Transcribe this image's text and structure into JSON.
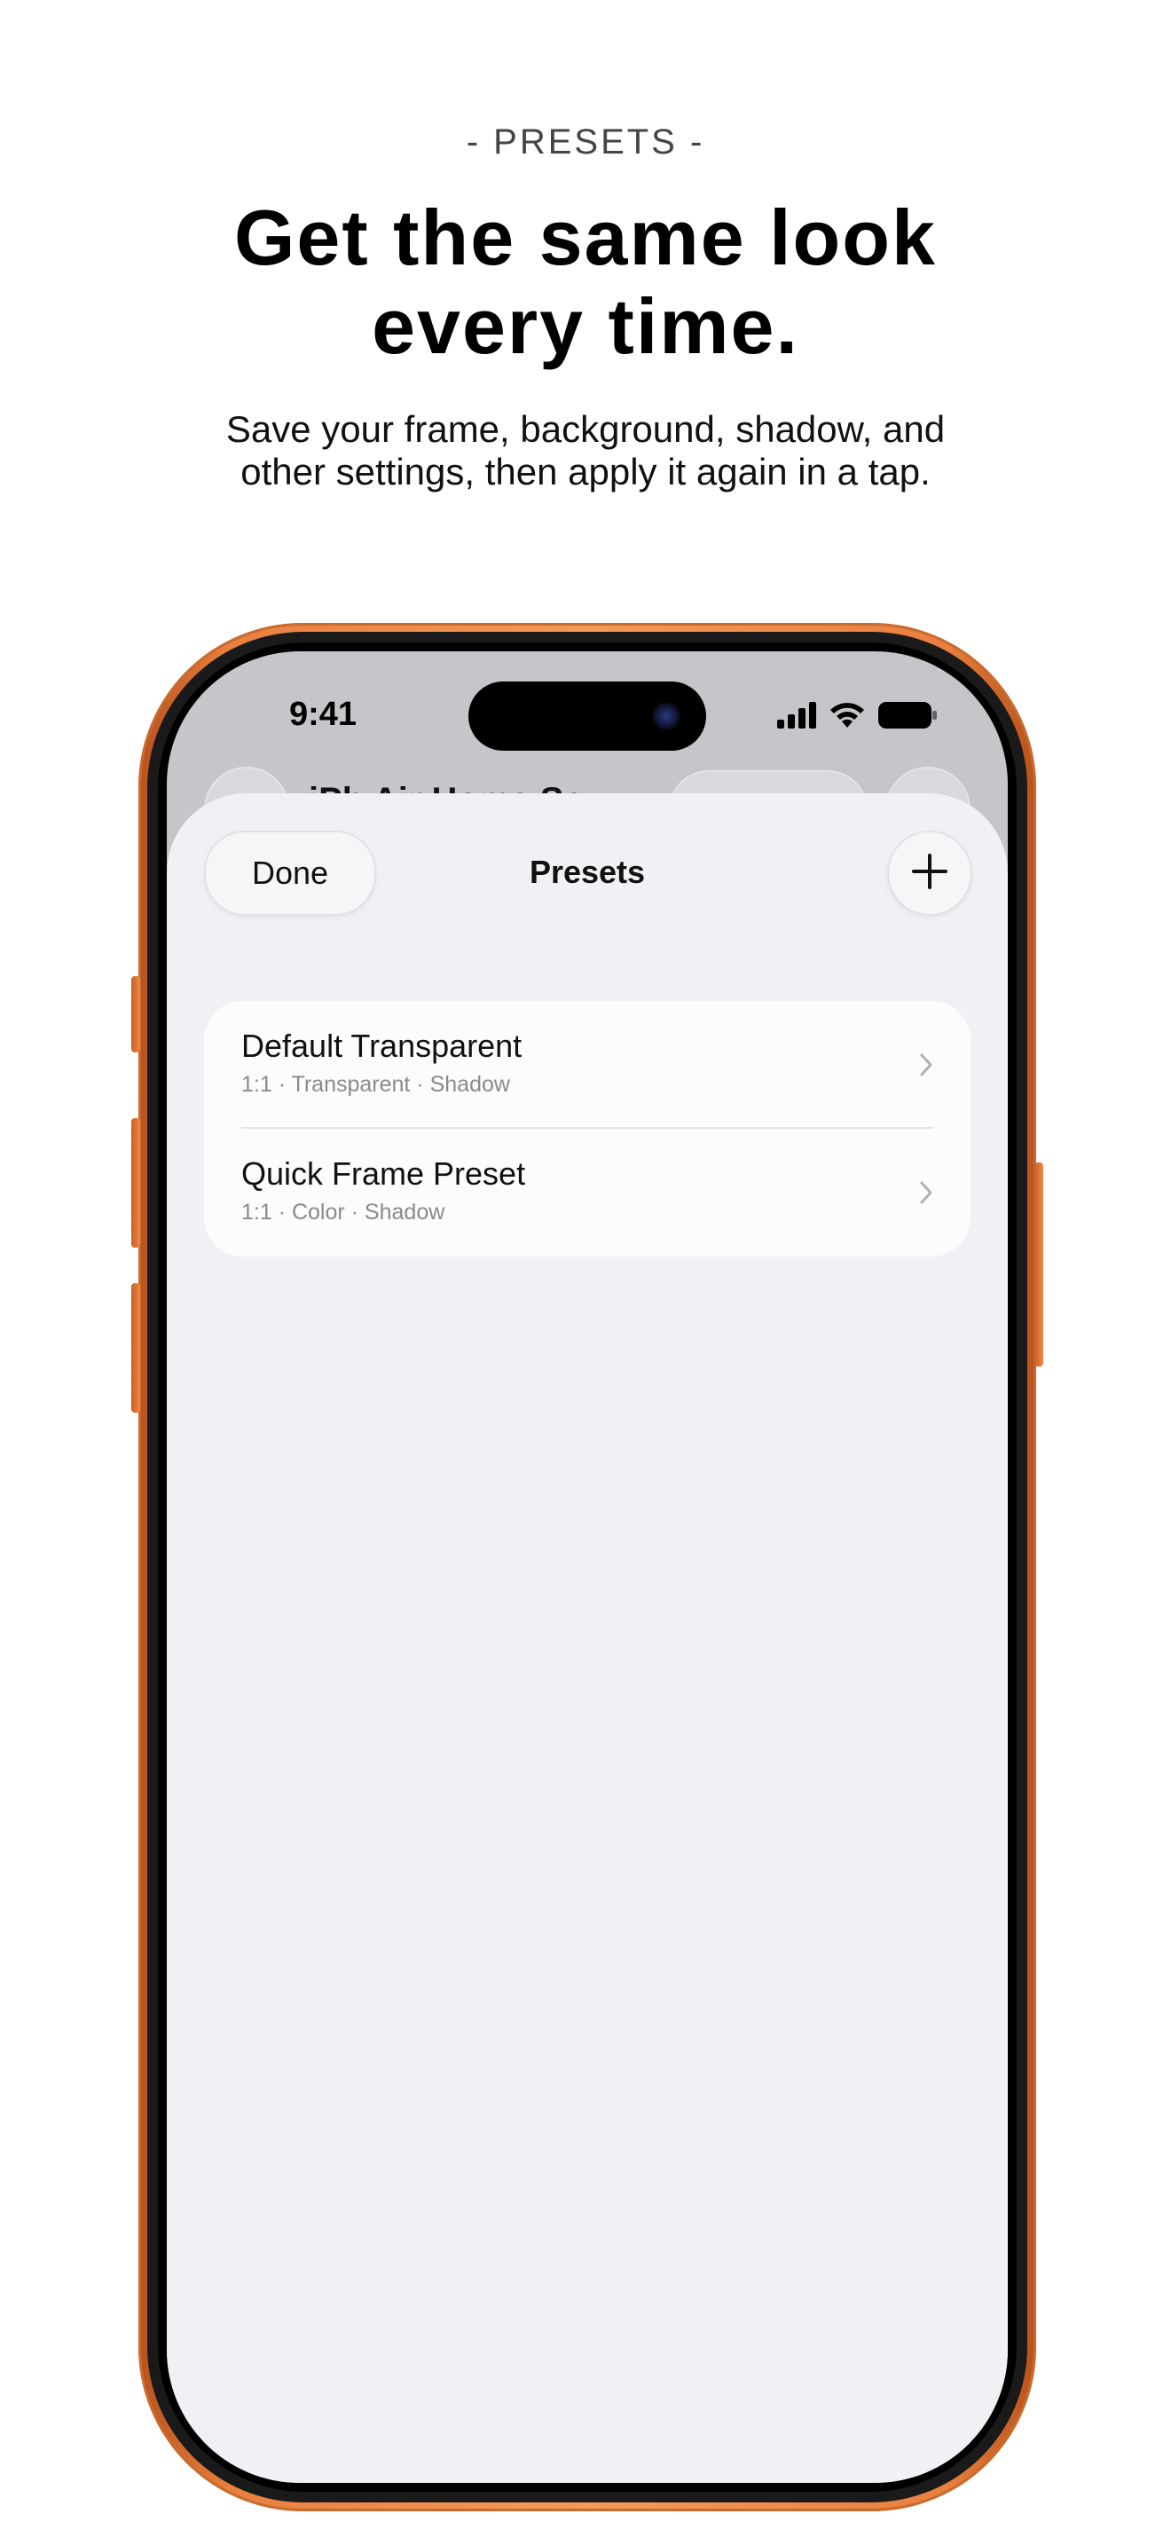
{
  "marketing": {
    "eyebrow": "- PRESETS -",
    "headline_line1": "Get the same look",
    "headline_line2": "every time.",
    "subhead": "Save your frame, background, shadow, and other settings, then apply it again in a tap."
  },
  "status_bar": {
    "time": "9:41",
    "icons": [
      "cellular-signal-icon",
      "wifi-icon",
      "battery-icon"
    ]
  },
  "background_nav": {
    "title_partial": "iPh    Air Home Sc"
  },
  "sheet": {
    "done_label": "Done",
    "title": "Presets",
    "add_icon": "plus-icon"
  },
  "presets": [
    {
      "name": "Default Transparent",
      "meta": "1:1 · Transparent · Shadow"
    },
    {
      "name": "Quick Frame Preset",
      "meta": "1:1 · Color · Shadow"
    }
  ],
  "colors": {
    "device_frame": "#e8803f",
    "sheet_background": "#f1f1f5",
    "list_background": "#fcfcfc",
    "secondary_text": "#8a8a8e"
  }
}
